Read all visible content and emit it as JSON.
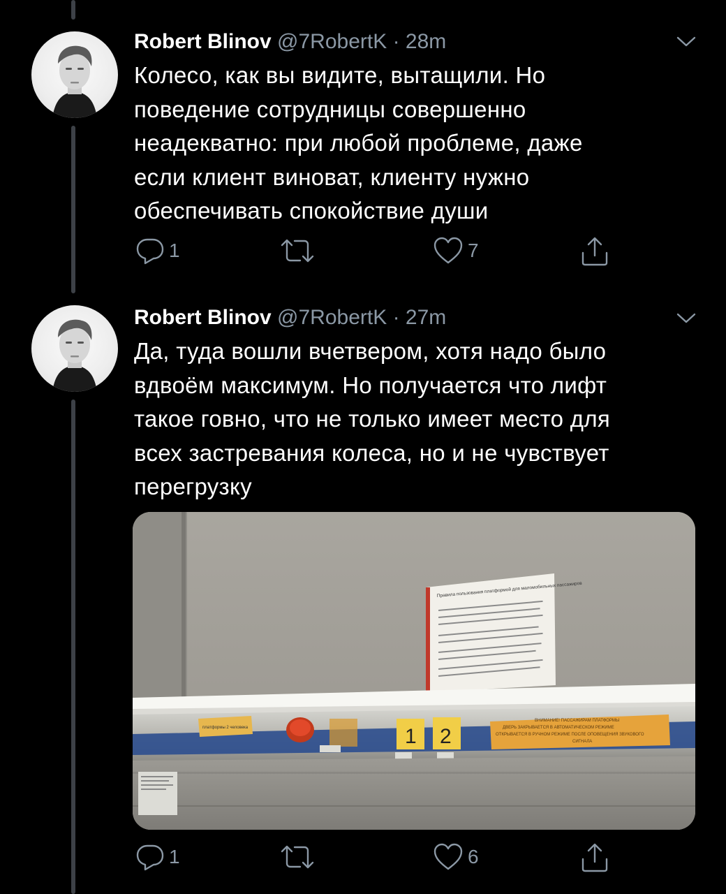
{
  "tweets": [
    {
      "author_name": "Robert Blinov",
      "handle": "@7RobertK",
      "separator": "·",
      "time": "28m",
      "text_lines": [
        "Колесо, как вы видите, вытащили. Но",
        "поведение сотрудницы совершенно",
        "неадекватно: при любой проблеме, даже",
        "если клиент виноват, клиенту нужно",
        "обеспечивать спокойствие души"
      ],
      "reply_count": "1",
      "retweet_count": "",
      "like_count": "7"
    },
    {
      "author_name": "Robert Blinov",
      "handle": "@7RobertK",
      "separator": "·",
      "time": "27m",
      "text_lines": [
        "Да, туда вошли вчетвером, хотя надо было",
        "вдвоём максимум. Но получается что лифт",
        "такое говно, что не только имеет место для",
        "всех застревания колеса, но и не чувствует",
        "перегрузку"
      ],
      "reply_count": "1",
      "retweet_count": "",
      "like_count": "6",
      "photo": {
        "sign_title": "Правила пользования платформой для маломобильных пассажиров",
        "panel_label_left": "платформы 2 человека",
        "floor_buttons": [
          "1",
          "2"
        ],
        "notice_lines": [
          "ВНИМАНИЕ! ПАССАЖИРАМ ПЛАТФОРМЫ",
          "ДВЕРЬ ЗАКРЫВАЕТСЯ В АВТОМАТИЧЕСКОМ РЕЖИМЕ",
          "ОТКРЫВАЕТСЯ В РУЧНОМ РЕЖИМЕ ПОСЛЕ ОПОВЕЩЕНИЯ ЗВУКОВОГО",
          "СИГНАЛА"
        ]
      }
    }
  ],
  "colors": {
    "background": "#000000",
    "secondary_text": "#8b98a5",
    "thread_line": "#3d4147"
  },
  "icons": {
    "reply": "reply-icon",
    "retweet": "retweet-icon",
    "like": "heart-icon",
    "share": "share-icon",
    "caret": "chevron-down-icon"
  }
}
